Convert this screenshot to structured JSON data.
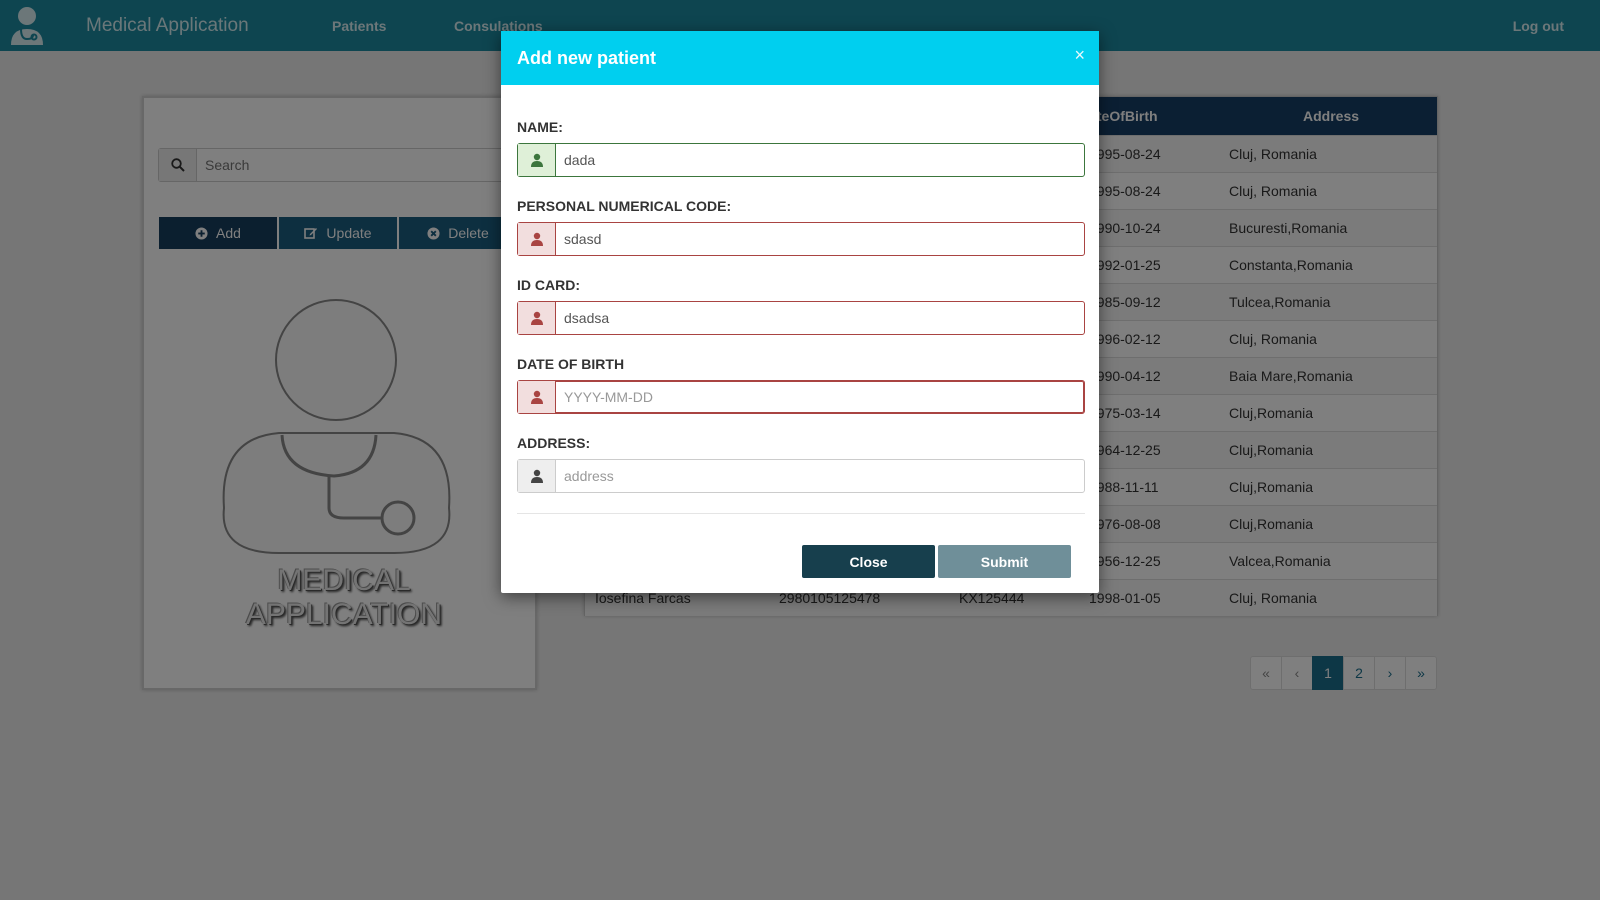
{
  "navbar": {
    "brand": "Medical Application",
    "links": {
      "patients": "Patients",
      "consultations": "Consulations",
      "logout": "Log out"
    },
    "logo_icon": "doctor-icon"
  },
  "left_panel": {
    "search_placeholder": "Search",
    "buttons": {
      "add": "Add",
      "update": "Update",
      "delete": "Delete"
    },
    "logo_text_line1": "MEDICAL",
    "logo_text_line2": "APPLICATION"
  },
  "table": {
    "headers": {
      "dob": "DateOfBirth",
      "address": "Address"
    },
    "rows": [
      {
        "name": "",
        "pnc": "",
        "id_card": "",
        "dob": "1995-08-24",
        "address": "Cluj, Romania"
      },
      {
        "name": "",
        "pnc": "",
        "id_card": "",
        "dob": "1995-08-24",
        "address": "Cluj, Romania"
      },
      {
        "name": "",
        "pnc": "",
        "id_card": "",
        "dob": "1990-10-24",
        "address": "Bucuresti,Romania"
      },
      {
        "name": "",
        "pnc": "",
        "id_card": "",
        "dob": "1992-01-25",
        "address": "Constanta,Romania"
      },
      {
        "name": "",
        "pnc": "",
        "id_card": "",
        "dob": "1985-09-12",
        "address": "Tulcea,Romania"
      },
      {
        "name": "",
        "pnc": "",
        "id_card": "",
        "dob": "1996-02-12",
        "address": "Cluj, Romania"
      },
      {
        "name": "",
        "pnc": "",
        "id_card": "",
        "dob": "1990-04-12",
        "address": "Baia Mare,Romania"
      },
      {
        "name": "",
        "pnc": "",
        "id_card": "",
        "dob": "1975-03-14",
        "address": "Cluj,Romania"
      },
      {
        "name": "",
        "pnc": "",
        "id_card": "",
        "dob": "1964-12-25",
        "address": "Cluj,Romania"
      },
      {
        "name": "",
        "pnc": "",
        "id_card": "",
        "dob": "1988-11-11",
        "address": "Cluj,Romania"
      },
      {
        "name": "",
        "pnc": "",
        "id_card": "",
        "dob": "1976-08-08",
        "address": "Cluj,Romania"
      },
      {
        "name": "",
        "pnc": "",
        "id_card": "",
        "dob": "1956-12-25",
        "address": "Valcea,Romania"
      },
      {
        "name": "Iosefina Farcas",
        "pnc": "2980105125478",
        "id_card": "KX125444",
        "dob": "1998-01-05",
        "address": "Cluj, Romania"
      }
    ]
  },
  "pagination": {
    "first": "«",
    "prev": "‹",
    "pages": [
      "1",
      "2"
    ],
    "active_page": "1",
    "next": "›",
    "last": "»"
  },
  "modal": {
    "title": "Add new patient",
    "close_icon": "×",
    "fields": {
      "name": {
        "label": "NAME:",
        "value": "dada",
        "placeholder": "",
        "state": "valid"
      },
      "pnc": {
        "label": "PERSONAL NUMERICAL CODE:",
        "value": "sdasd",
        "placeholder": "",
        "state": "invalid"
      },
      "id_card": {
        "label": "ID CARD:",
        "value": "dsadsa",
        "placeholder": "",
        "state": "invalid"
      },
      "dob": {
        "label": "DATE OF BIRTH",
        "value": "",
        "placeholder": "YYYY-MM-DD",
        "state": "invalid"
      },
      "address": {
        "label": "ADDRESS:",
        "value": "",
        "placeholder": "address",
        "state": "neutral"
      }
    },
    "buttons": {
      "close": "Close",
      "submit": "Submit"
    }
  },
  "colors": {
    "navbar": "#1c8aa0",
    "modal_header": "#00cfef",
    "valid": "#3c763d",
    "invalid": "#a94442",
    "table_header": "#173f66"
  }
}
